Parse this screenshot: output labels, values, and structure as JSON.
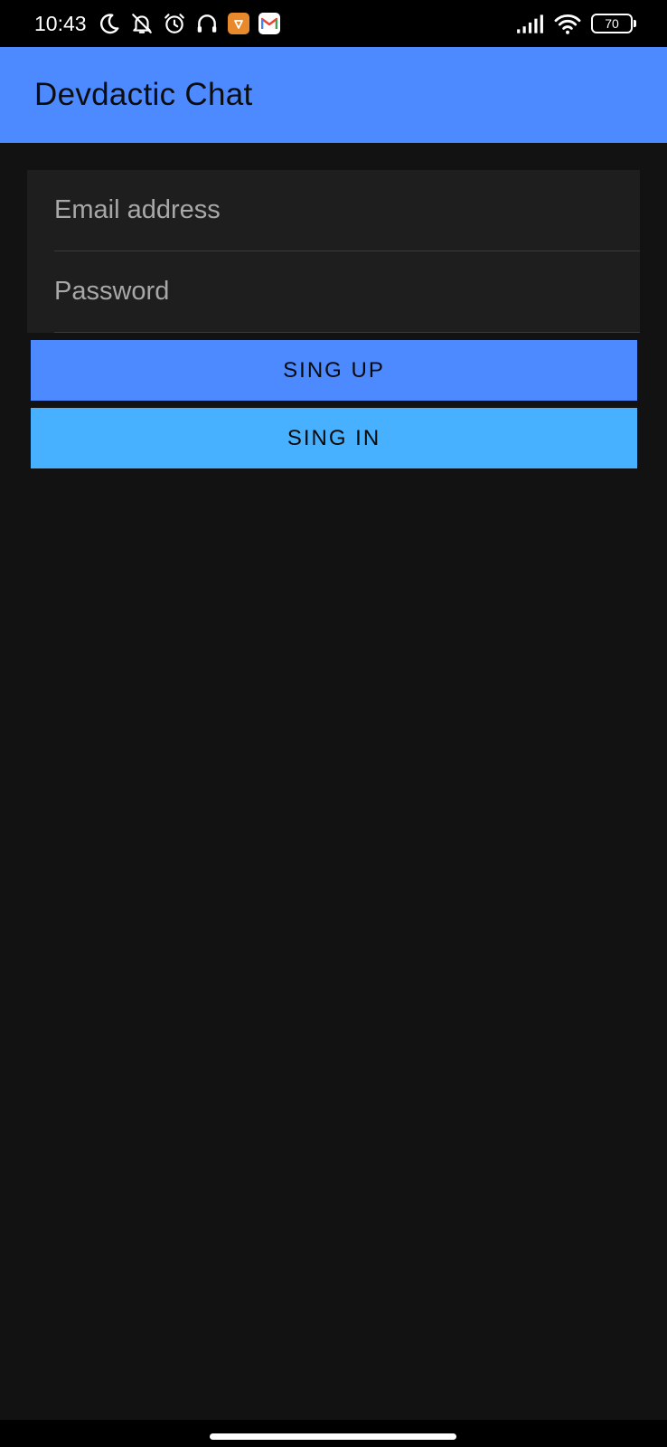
{
  "status_bar": {
    "time": "10:43",
    "battery_level": "70",
    "icons": [
      "moon-icon",
      "notifications-off-icon",
      "alarm-icon",
      "headset-icon",
      "app-notification-icon",
      "gmail-icon",
      "signal-icon",
      "wifi-icon",
      "battery-icon"
    ]
  },
  "app_bar": {
    "title": "Devdactic Chat"
  },
  "form": {
    "email_placeholder": "Email address",
    "email_value": "",
    "password_placeholder": "Password",
    "password_value": ""
  },
  "buttons": {
    "sign_up_label": "SING UP",
    "sign_in_label": "SING IN"
  },
  "colors": {
    "primary": "#4d8aff",
    "secondary": "#47b0ff",
    "background": "#121212",
    "card": "#1e1e1e"
  }
}
